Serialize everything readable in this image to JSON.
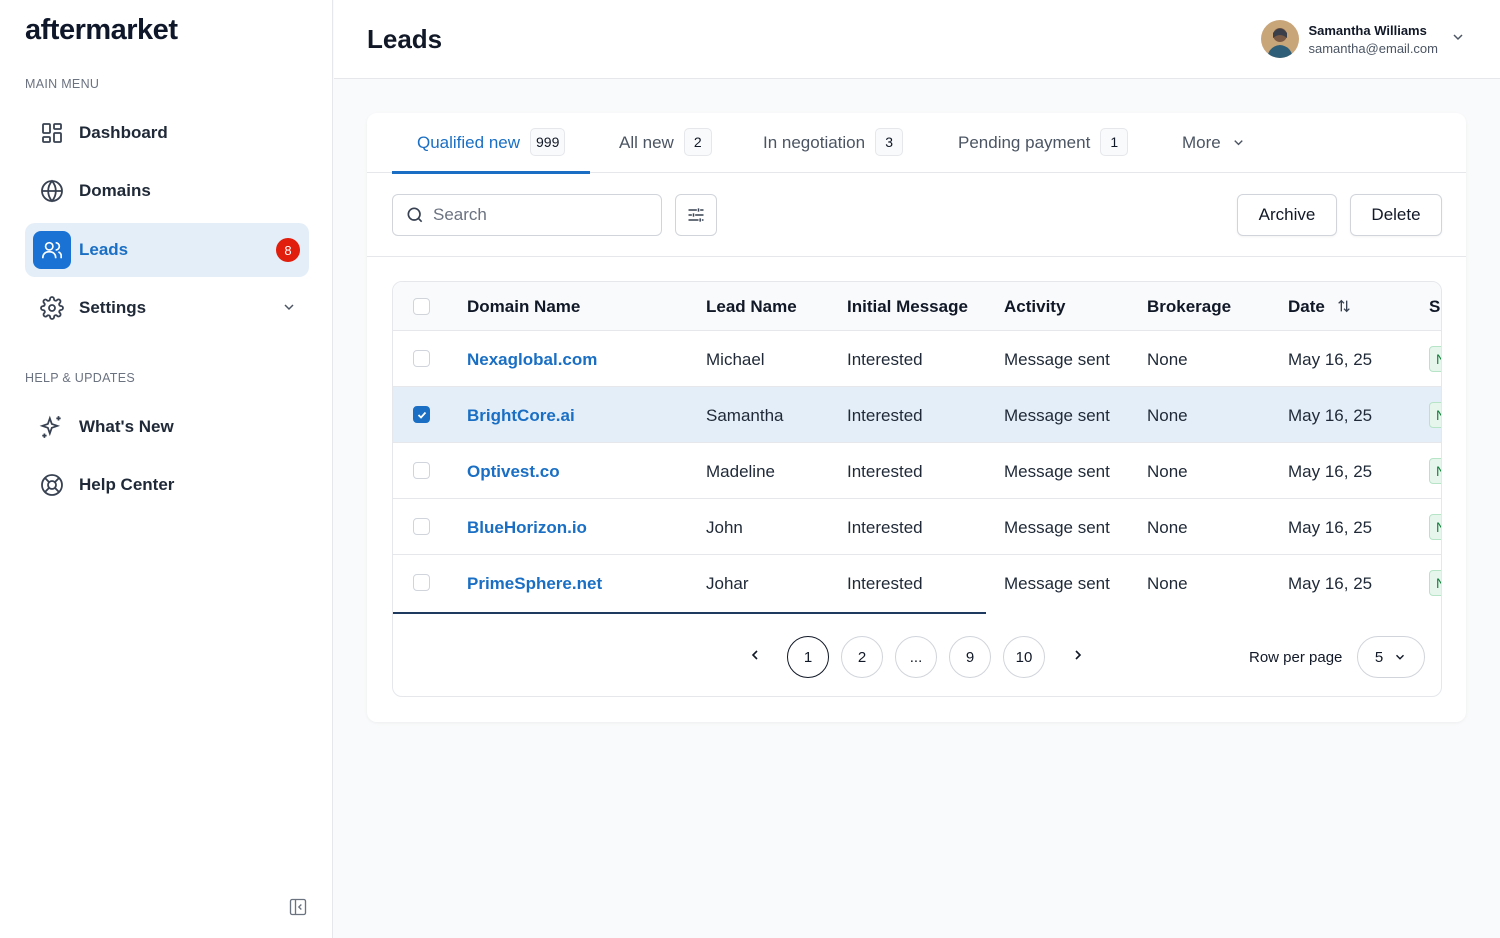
{
  "app": {
    "logo": "aftermarket"
  },
  "sidebar": {
    "main_menu_label": "MAIN MENU",
    "help_label": "HELP & UPDATES",
    "items": [
      {
        "label": "Dashboard",
        "icon": "dashboard-icon"
      },
      {
        "label": "Domains",
        "icon": "globe-icon"
      },
      {
        "label": "Leads",
        "icon": "users-icon",
        "badge": "8",
        "active": true
      },
      {
        "label": "Settings",
        "icon": "gear-icon"
      }
    ],
    "help_items": [
      {
        "label": "What's New",
        "icon": "sparkle-icon"
      },
      {
        "label": "Help Center",
        "icon": "lifebuoy-icon"
      }
    ]
  },
  "header": {
    "title": "Leads",
    "user": {
      "name": "Samantha Williams",
      "email": "samantha@email.com"
    }
  },
  "tabs": [
    {
      "label": "Qualified new",
      "count": "999",
      "active": true
    },
    {
      "label": "All new",
      "count": "2"
    },
    {
      "label": "In negotiation",
      "count": "3"
    },
    {
      "label": "Pending payment",
      "count": "1"
    },
    {
      "label": "More"
    }
  ],
  "toolbar": {
    "search_placeholder": "Search",
    "archive_label": "Archive",
    "delete_label": "Delete"
  },
  "table": {
    "columns": [
      "Domain Name",
      "Lead Name",
      "Initial Message",
      "Activity",
      "Brokerage",
      "Date",
      "S"
    ],
    "rows": [
      {
        "domain": "Nexaglobal.com",
        "lead": "Michael",
        "message": "Interested",
        "activity": "Message sent",
        "brokerage": "None",
        "date": "May 16, 25",
        "status": "N",
        "checked": false
      },
      {
        "domain": "BrightCore.ai",
        "lead": "Samantha",
        "message": "Interested",
        "activity": "Message sent",
        "brokerage": "None",
        "date": "May 16, 25",
        "status": "N",
        "checked": true
      },
      {
        "domain": "Optivest.co",
        "lead": "Madeline",
        "message": "Interested",
        "activity": "Message sent",
        "brokerage": "None",
        "date": "May 16, 25",
        "status": "N",
        "checked": false
      },
      {
        "domain": "BlueHorizon.io",
        "lead": "John",
        "message": "Interested",
        "activity": "Message sent",
        "brokerage": "None",
        "date": "May 16, 25",
        "status": "N",
        "checked": false
      },
      {
        "domain": "PrimeSphere.net",
        "lead": "Johar",
        "message": "Interested",
        "activity": "Message sent",
        "brokerage": "None",
        "date": "May 16, 25",
        "status": "N",
        "checked": false
      }
    ]
  },
  "pagination": {
    "pages": [
      "1",
      "2",
      "...",
      "9",
      "10"
    ],
    "current": "1",
    "rows_per_page_label": "Row per page",
    "rows_per_page": "5"
  },
  "colors": {
    "accent": "#1a6fc4",
    "active_bg": "#e4eef8",
    "badge": "#e11d0c"
  }
}
